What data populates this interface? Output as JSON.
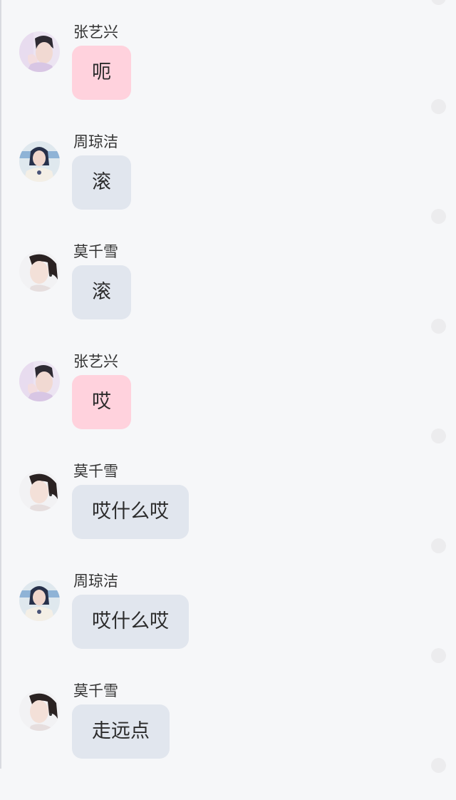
{
  "messages": [
    {
      "sender": "张艺兴",
      "text": "呃",
      "avatar": "male-portrait-avatar",
      "bubble_color": "#ffd2dd"
    },
    {
      "sender": "周琼洁",
      "text": "滚",
      "avatar": "female-portrait-blue-avatar",
      "bubble_color": "#e1e6ee"
    },
    {
      "sender": "莫千雪",
      "text": "滚",
      "avatar": "female-portrait-profile-avatar",
      "bubble_color": "#e1e6ee"
    },
    {
      "sender": "张艺兴",
      "text": "哎",
      "avatar": "male-portrait-avatar",
      "bubble_color": "#ffd2dd"
    },
    {
      "sender": "莫千雪",
      "text": "哎什么哎",
      "avatar": "female-portrait-profile-avatar",
      "bubble_color": "#e1e6ee"
    },
    {
      "sender": "周琼洁",
      "text": "哎什么哎",
      "avatar": "female-portrait-blue-avatar",
      "bubble_color": "#e1e6ee"
    },
    {
      "sender": "莫千雪",
      "text": "走远点",
      "avatar": "female-portrait-profile-avatar",
      "bubble_color": "#e1e6ee"
    }
  ]
}
